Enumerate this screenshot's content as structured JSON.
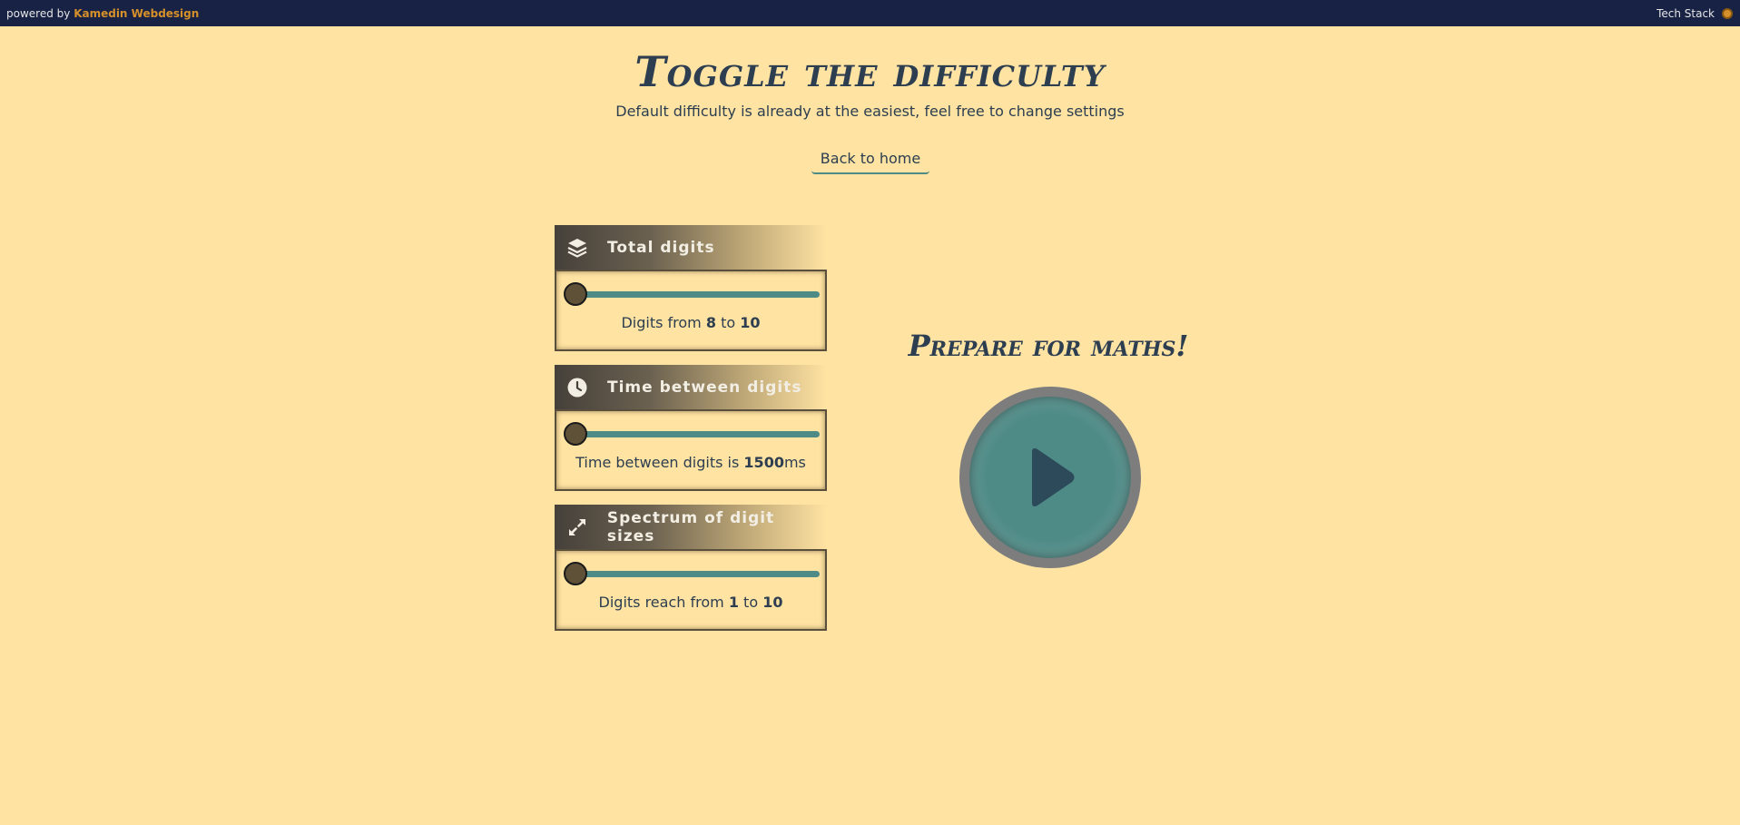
{
  "topbar": {
    "powered_prefix": "powered by",
    "brand": "Kamedin Webdesign",
    "tech_stack": "Tech Stack"
  },
  "header": {
    "title": "Toggle the difficulty",
    "subtitle": "Default difficulty is already at the easiest, feel free to change settings",
    "back_link": "Back to home"
  },
  "settings": [
    {
      "icon": "layers-icon",
      "label": "Total digits",
      "slider_position": 0,
      "text_prefix": "Digits from",
      "value_a": "8",
      "text_mid": "to",
      "value_b": "10",
      "text_suffix": ""
    },
    {
      "icon": "clock-icon",
      "label": "Time between digits",
      "slider_position": 0,
      "text_prefix": "Time between digits is",
      "value_a": "1500",
      "text_suffix": "ms"
    },
    {
      "icon": "expand-icon",
      "label": "Spectrum of digit sizes",
      "slider_position": 0,
      "text_prefix": "Digits reach from",
      "value_a": "1",
      "text_mid": "to",
      "value_b": "10",
      "text_suffix": ""
    }
  ],
  "play": {
    "heading": "Prepare for maths!",
    "icon": "play-icon"
  },
  "colors": {
    "background": "#ffe3a3",
    "topbar": "#172245",
    "accent": "#4e8a86",
    "brand": "#d6902a",
    "text": "#2c3e50"
  }
}
